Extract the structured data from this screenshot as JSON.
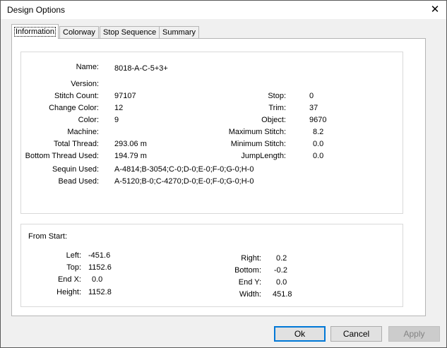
{
  "window": {
    "title": "Design Options",
    "close_glyph": "✕"
  },
  "tabs": [
    {
      "label": "Information",
      "active": true
    },
    {
      "label": "Colorway",
      "active": false
    },
    {
      "label": "Stop Sequence",
      "active": false
    },
    {
      "label": "Summary",
      "active": false
    }
  ],
  "info": {
    "name_label": "Name:",
    "name_value": "8018-A-C-5+3+",
    "version_label": "Version:",
    "stitch_count_label": "Stitch Count:",
    "stitch_count_value": "97107",
    "change_color_label": "Change Color:",
    "change_color_value": "12",
    "color_label": "Color:",
    "color_value": "9",
    "machine_label": "Machine:",
    "total_thread_label": "Total Thread:",
    "total_thread_value": "293.06 m",
    "bottom_thread_label": "Bottom Thread Used:",
    "bottom_thread_value": "194.79 m",
    "sequin_label": "Sequin Used:",
    "sequin_value": "A-4814;B-3054;C-0;D-0;E-0;F-0;G-0;H-0",
    "bead_label": "Bead Used:",
    "bead_value": "A-5120;B-0;C-4270;D-0;E-0;F-0;G-0;H-0",
    "stop_label": "Stop:",
    "stop_value": "0",
    "trim_label": "Trim:",
    "trim_value": "37",
    "object_label": "Object:",
    "object_value": "9670",
    "max_stitch_label": "Maximum Stitch:",
    "max_stitch_value": "8.2",
    "min_stitch_label": "Minimum Stitch:",
    "min_stitch_value": "0.0",
    "jump_label": "JumpLength:",
    "jump_value": "0.0"
  },
  "from_start": {
    "heading": "From Start:",
    "left_label": "Left:",
    "left_value": "-451.6",
    "top_label": "Top:",
    "top_value": "1152.6",
    "endx_label": "End X:",
    "endx_value": "0.0",
    "height_label": "Height:",
    "height_value": "1152.8",
    "right_label": "Right:",
    "right_value": "0.2",
    "bottom_label": "Bottom:",
    "bottom_value": "-0.2",
    "endy_label": "End Y:",
    "endy_value": "0.0",
    "width_label": "Width:",
    "width_value": "451.8"
  },
  "buttons": {
    "ok": "Ok",
    "cancel": "Cancel",
    "apply": "Apply"
  },
  "colors": {
    "default_button_border": "#0078d7",
    "disabled_text": "#838383"
  }
}
